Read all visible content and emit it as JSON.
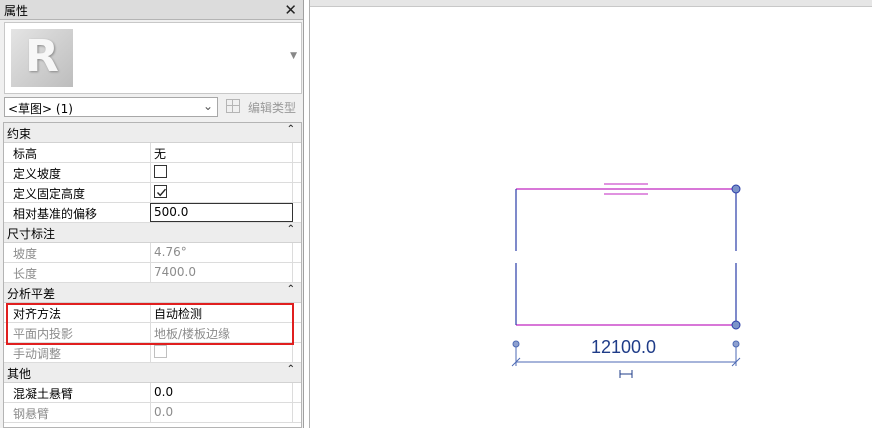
{
  "palette": {
    "title": "属性",
    "close": "✕",
    "type_selector": {
      "value": "<草图> (1)",
      "arrow": "⌄"
    },
    "edit_type": "编辑类型",
    "groups": [
      {
        "label": "约束",
        "collapse": "⌃"
      },
      {
        "label": "尺寸标注",
        "collapse": "⌃"
      },
      {
        "label": "分析平差",
        "collapse": "⌃"
      },
      {
        "label": "其他",
        "collapse": "⌃"
      }
    ],
    "constraints": {
      "level": {
        "name": "标高",
        "value": "无"
      },
      "define_slope": {
        "name": "定义坡度",
        "checked": false
      },
      "define_fixed_height": {
        "name": "定义固定高度",
        "checked": true
      },
      "offset": {
        "name": "相对基准的偏移",
        "value": "500.0"
      }
    },
    "dimensions": {
      "slope": {
        "name": "坡度",
        "value": "4.76°"
      },
      "length": {
        "name": "长度",
        "value": "7400.0"
      }
    },
    "analytical": {
      "alignment": {
        "name": "对齐方法",
        "value": "自动检测"
      },
      "projection": {
        "name": "平面内投影",
        "value": "地板/楼板边缘"
      },
      "manual": {
        "name": "手动调整",
        "checked": false
      }
    },
    "other": {
      "concrete_cantilever": {
        "name": "混凝土悬臂",
        "value": "0.0"
      },
      "steel_cantilever": {
        "name": "钢悬臂",
        "value": "0.0"
      }
    }
  },
  "drawing": {
    "dimension": "12100.0",
    "colors": {
      "sketch_line": "#c026c0",
      "edge": "#2a3ca8",
      "dimension": "#1f3c88",
      "highlight": "#e01f1f"
    }
  }
}
